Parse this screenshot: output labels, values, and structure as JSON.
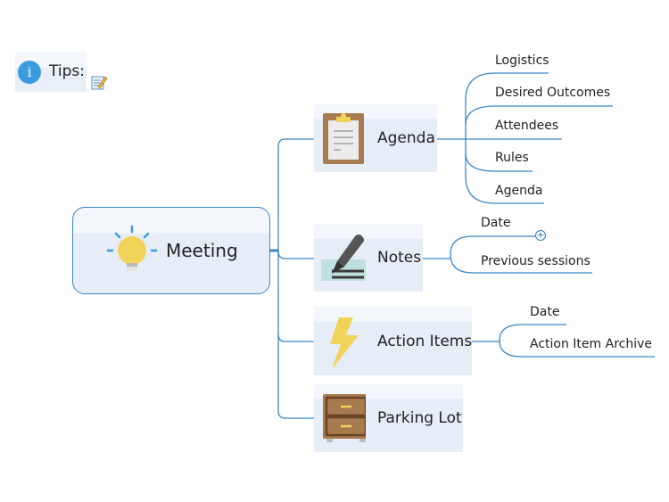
{
  "tips": {
    "icon": "info-icon",
    "label": "Tips:",
    "note_icon": "note-pencil-icon"
  },
  "central": {
    "label": "Meeting",
    "icon": "lightbulb-icon"
  },
  "topics": [
    {
      "label": "Agenda",
      "icon": "clipboard-icon",
      "subtopics": [
        "Logistics",
        "Desired Outcomes",
        "Attendees",
        "Rules",
        "Agenda"
      ]
    },
    {
      "label": "Notes",
      "icon": "pen-icon",
      "subtopics": [
        "Date",
        "Previous sessions"
      ],
      "collapsed_indicator": "+"
    },
    {
      "label": "Action Items",
      "icon": "lightning-icon",
      "subtopics": [
        "Date",
        "Action Item Archive"
      ]
    },
    {
      "label": "Parking Lot",
      "icon": "cabinet-icon",
      "subtopics": []
    }
  ],
  "colors": {
    "line": "#3b87c6",
    "accent_info": "#3b9be0",
    "icon_yellow": "#f2d35a",
    "icon_brown": "#a87a4f"
  }
}
